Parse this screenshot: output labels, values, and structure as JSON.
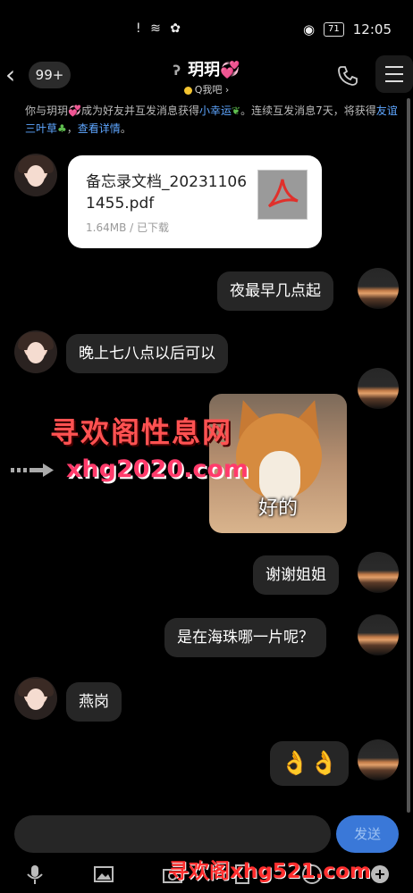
{
  "status_bar": {
    "icons": "! ≋ ✿",
    "battery": "71",
    "time": "12:05"
  },
  "header": {
    "unread_badge": "99+",
    "contact_name": "玥玥",
    "heart": "💞",
    "subtitle": "Q我吧 ›"
  },
  "notice": {
    "part1": "你与玥玥",
    "part2": "成为好友并互发消息获得",
    "link1": "小幸运",
    "part3": "。连续互发消息7天，将获得",
    "link2": "友谊三叶草",
    "part4": "，",
    "link3": "查看详情",
    "part5": "。"
  },
  "messages": {
    "file_name": "备忘录文档_202311061455.pdf",
    "file_meta": "1.64MB / 已下载",
    "m1": "夜最早几点起",
    "m2": "晚上七八点以后可以",
    "sticker_text": "好的",
    "m3": "谢谢姐姐",
    "m4": "是在海珠哪一片呢？",
    "m5": "燕岗",
    "m6": "👌👌"
  },
  "watermarks": {
    "line1": "寻欢阁性息网",
    "line2": "xhg2020.com",
    "line3": "寻欢阁xhg521.com"
  },
  "composer": {
    "send_label": "发送"
  }
}
